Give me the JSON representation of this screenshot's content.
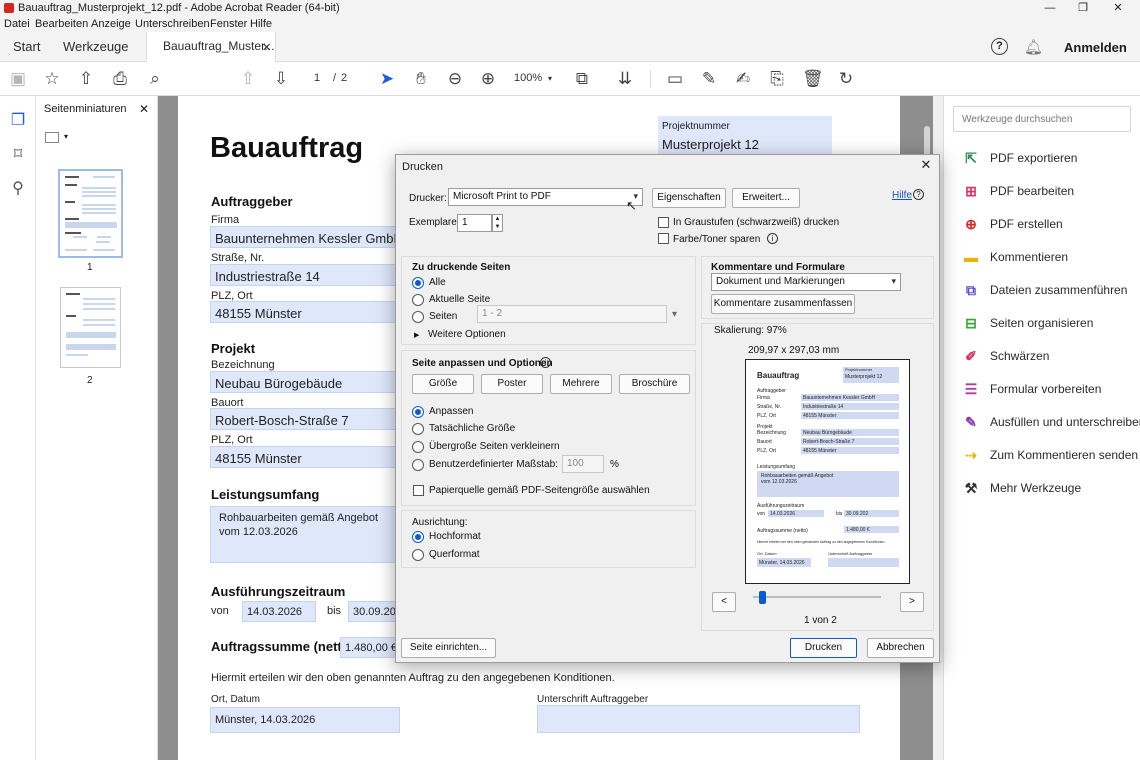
{
  "window": {
    "title": "Bauauftrag_Musterprojekt_12.pdf - Adobe Acrobat Reader (64-bit)",
    "controls": [
      "—",
      "❐",
      "✕"
    ]
  },
  "menu": [
    "Datei",
    "Bearbeiten",
    "Anzeige",
    "Unterschreiben",
    "Fenster",
    "Hilfe"
  ],
  "tabs": {
    "start": "Start",
    "tools": "Werkzeuge",
    "document": "Bauauftrag_Muster...",
    "close": "✕"
  },
  "header": {
    "help": "?",
    "signin": "Anmelden"
  },
  "toolbar": {
    "page_current": "1",
    "page_sep": "/",
    "page_total": "2",
    "zoom": "100%"
  },
  "thumbnails": {
    "title": "Seitenminiaturen",
    "close": "✕",
    "page1": "1",
    "page2": "2"
  },
  "document": {
    "title": "Bauauftrag",
    "project_number_label": "Projektnummer",
    "project_number": "Musterprojekt 12",
    "section_client": "Auftraggeber",
    "company_label": "Firma",
    "company": "Bauunternehmen Kessler GmbH",
    "street_label": "Straße, Nr.",
    "street": "Industriestraße 14",
    "city_label": "PLZ, Ort",
    "city": "48155 Münster",
    "section_project": "Projekt",
    "designation_label": "Bezeichnung",
    "designation": "Neubau Bürogebäude",
    "site_label": "Bauort",
    "site": "Robert-Bosch-Straße 7",
    "site_city_label": "PLZ, Ort",
    "site_city": "48155 Münster",
    "section_scope": "Leistungsumfang",
    "scope_line1": "Rohbauarbeiten gemäß Angebot",
    "scope_line2": "vom 12.03.2026",
    "section_period": "Ausführungszeitraum",
    "from_label": "von",
    "from": "14.03.2026",
    "to_label": "bis",
    "to": "30.09.202",
    "section_sum": "Auftragssumme (netto)",
    "sum": "1.480,00 €",
    "confirmation": "Hiermit erteilen wir den oben genannten Auftrag zu den angegebenen Konditionen.",
    "place_date_label": "Ort, Datum",
    "place_date": "Münster, 14.03.2026",
    "signature_label": "Unterschrift Auftraggeber"
  },
  "tools_panel": {
    "search_placeholder": "Werkzeuge durchsuchen",
    "items": [
      {
        "label": "PDF exportieren",
        "color": "#2e8b57"
      },
      {
        "label": "PDF bearbeiten",
        "color": "#d6336c"
      },
      {
        "label": "PDF erstellen",
        "color": "#d62b2b"
      },
      {
        "label": "Kommentieren",
        "color": "#e8b400"
      },
      {
        "label": "Dateien zusammenführen",
        "color": "#5a4fd6"
      },
      {
        "label": "Seiten organisieren",
        "color": "#3aa33a"
      },
      {
        "label": "Schwärzen",
        "color": "#d6336c"
      },
      {
        "label": "Formular vorbereiten",
        "color": "#b03a9e"
      },
      {
        "label": "Ausfüllen und unterschreiben",
        "color": "#8a3ab0"
      },
      {
        "label": "Zum Kommentieren senden",
        "color": "#e8b400"
      },
      {
        "label": "Mehr Werkzeuge",
        "color": "#333333"
      }
    ]
  },
  "print_dialog": {
    "title": "Drucken",
    "close": "✕",
    "printer_label": "Drucker:",
    "printer": "Microsoft Print to PDF",
    "properties_button": "Eigenschaften",
    "advanced_button": "Erweitert...",
    "help_link": "Hilfe",
    "copies_label": "Exemplare:",
    "copies": "1",
    "grayscale_label": "In Graustufen (schwarzweiß) drucken",
    "save_ink_label": "Farbe/Toner sparen",
    "pages_heading": "Zu druckende Seiten",
    "opt_all": "Alle",
    "opt_current": "Aktuelle Seite",
    "opt_pages": "Seiten",
    "pages_range": "1 - 2",
    "more_options": "Weitere Optionen",
    "sizing_heading": "Seite anpassen und Optionen",
    "btn_size": "Größe",
    "btn_poster": "Poster",
    "btn_multiple": "Mehrere",
    "btn_booklet": "Broschüre",
    "opt_fit": "Anpassen",
    "opt_actual": "Tatsächliche Größe",
    "opt_shrink": "Übergroße Seiten verkleinern",
    "opt_custom": "Benutzerdefinierter Maßstab:",
    "custom_value": "100",
    "percent": "%",
    "paper_source_label": "Papierquelle gemäß PDF-Seitengröße auswählen",
    "orientation_label": "Ausrichtung:",
    "opt_portrait": "Hochformat",
    "opt_landscape": "Querformat",
    "comments_heading": "Kommentare und Formulare",
    "comments_select": "Dokument und Markierungen",
    "summarize_button": "Kommentare zusammenfassen",
    "scale_label": "Skalierung:  97%",
    "paper_size": "209,97 x 297,03 mm",
    "page_indicator": "1 von 2",
    "prev": "<",
    "next": ">",
    "page_setup_button": "Seite einrichten...",
    "print_button": "Drucken",
    "cancel_button": "Abbrechen"
  }
}
